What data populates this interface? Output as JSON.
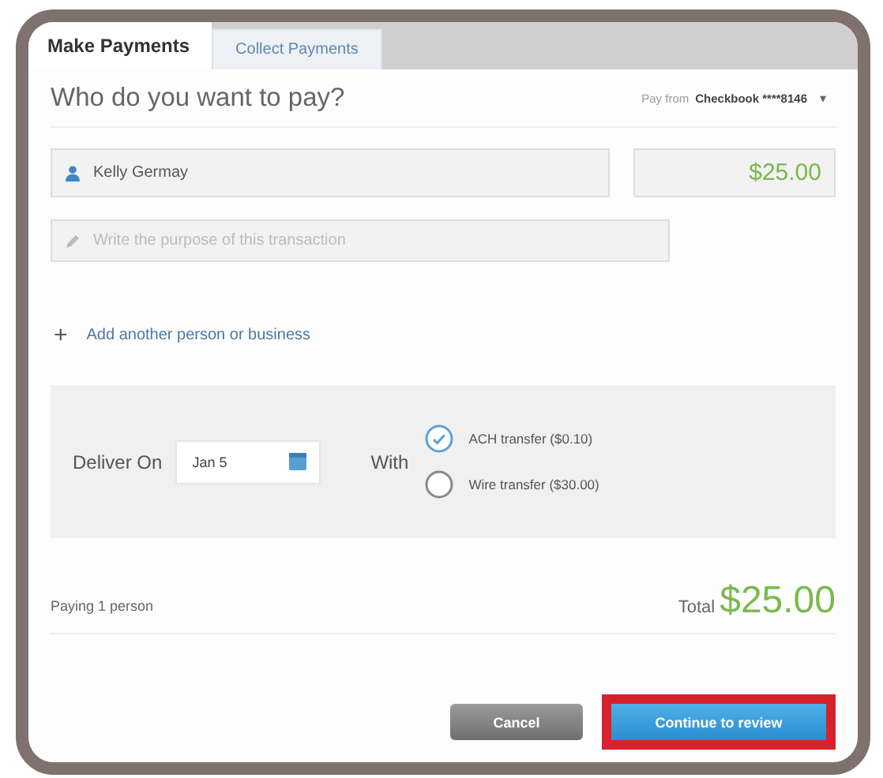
{
  "tabs": [
    {
      "label": "Make Payments",
      "selected": true
    },
    {
      "label": "Collect Payments",
      "selected": false
    }
  ],
  "heading": "Who do you want to pay?",
  "pay_from": {
    "label": "Pay from",
    "account": "Checkbook ****8146",
    "caret": "▾"
  },
  "payee": {
    "value": "Kelly Germay"
  },
  "amount": {
    "value": "$25.00"
  },
  "memo": {
    "placeholder": "Write the purpose of this transaction"
  },
  "add_link": {
    "icon": "+",
    "label": "Add another person or business"
  },
  "delivery": {
    "label": "Deliver On",
    "date": "Jan 5",
    "with_label": "With",
    "options": [
      {
        "label": "ACH transfer ($0.10)",
        "selected": true
      },
      {
        "label": "Wire transfer ($30.00)",
        "selected": false
      }
    ]
  },
  "summary": {
    "paying": "Paying 1 person",
    "total_label": "Total",
    "total": "$25.00"
  },
  "buttons": [
    {
      "kind": "secondary",
      "label": "Cancel",
      "highlighted": false
    },
    {
      "kind": "primary",
      "label": "Continue to review",
      "highlighted": true
    }
  ]
}
